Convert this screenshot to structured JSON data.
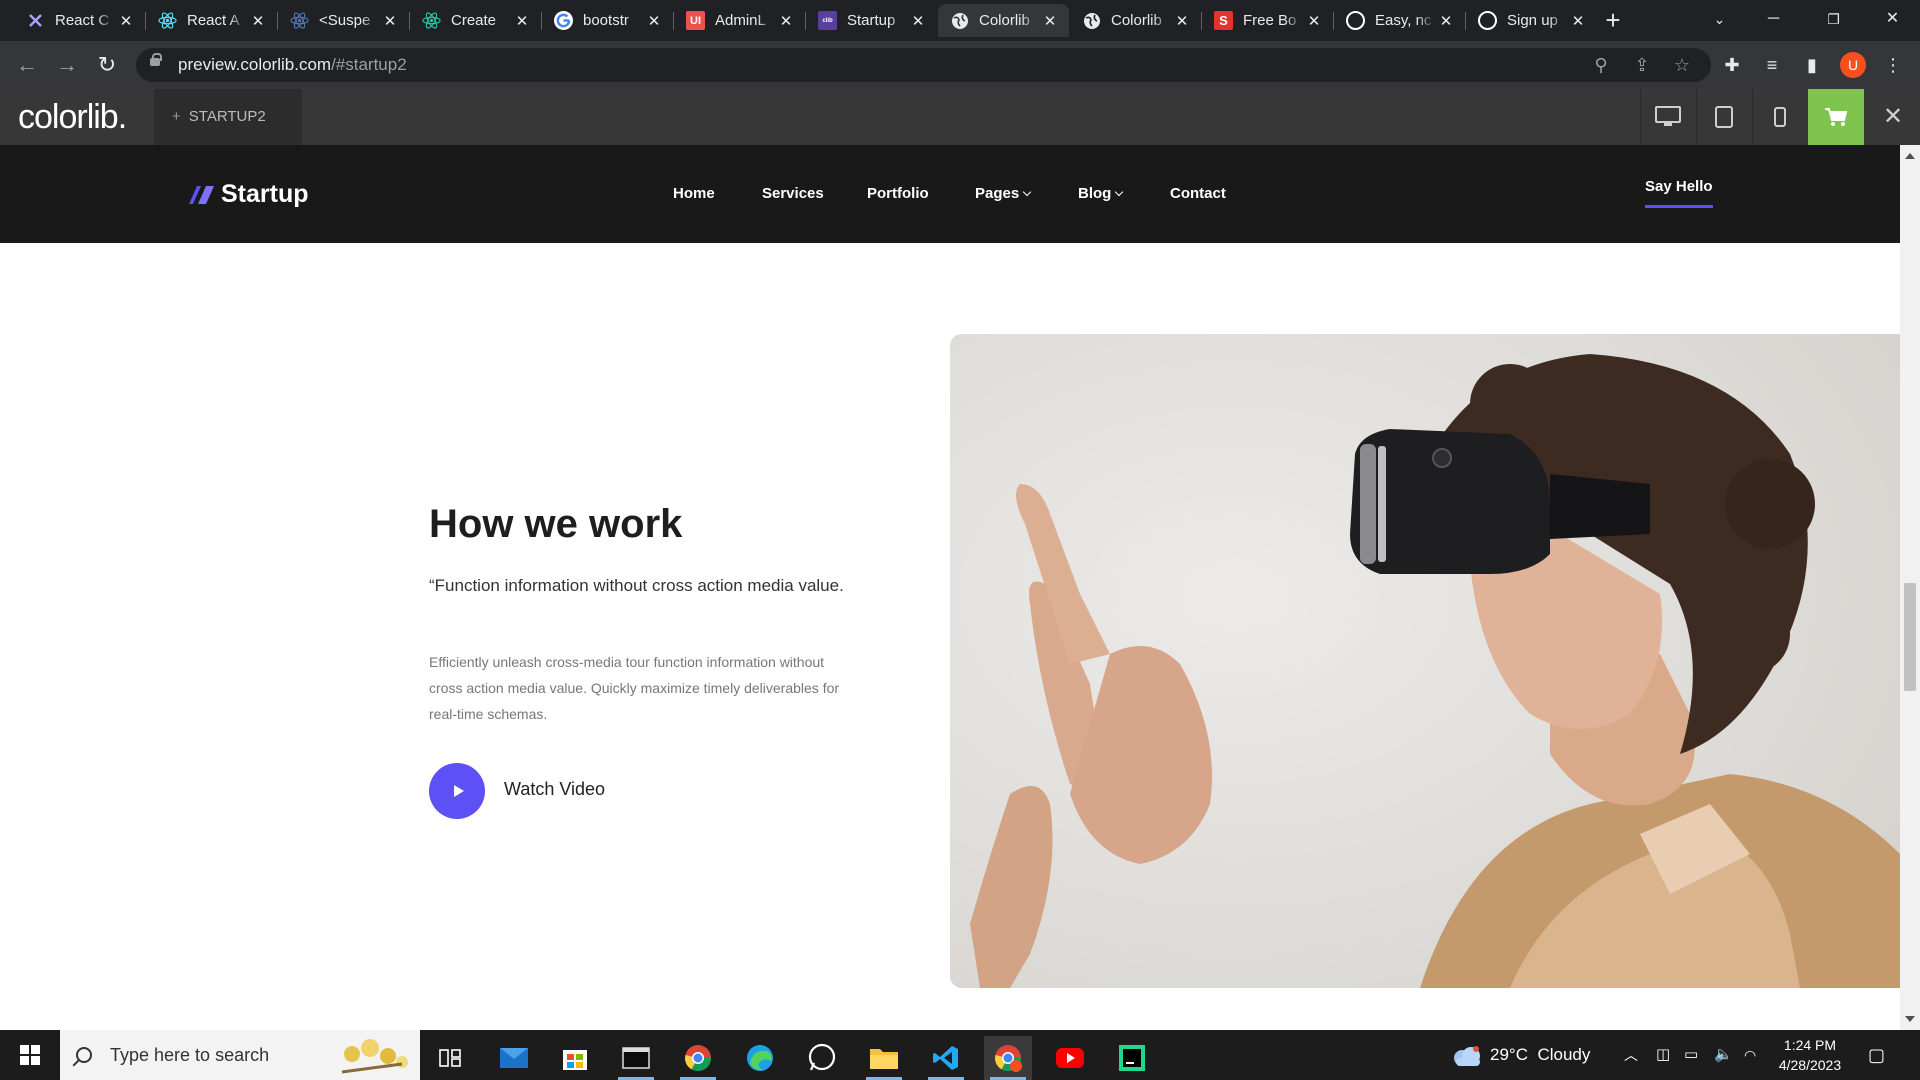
{
  "browser": {
    "tabs": [
      {
        "label": "React C",
        "favicon": "redux-icon",
        "color": "#764abc"
      },
      {
        "label": "React A",
        "favicon": "react-icon",
        "color": "#61dafb"
      },
      {
        "label": "<Suspe",
        "favicon": "react-icon",
        "color": "#61dafb"
      },
      {
        "label": "Create",
        "favicon": "react-icon",
        "color": "#61dafb"
      },
      {
        "label": "bootstr",
        "favicon": "google-icon",
        "color": "#ffffff"
      },
      {
        "label": "AdminL",
        "favicon": "ui-icon",
        "color": "#e8534b"
      },
      {
        "label": "Startup",
        "favicon": "colorlib-icon",
        "color": "#5a3ea0"
      },
      {
        "label": "Colorlib",
        "favicon": "globe-icon",
        "color": "#e8eaed",
        "active": true
      },
      {
        "label": "Colorlib",
        "favicon": "globe-icon",
        "color": "#e8eaed"
      },
      {
        "label": "Free Bo",
        "favicon": "s-icon",
        "color": "#e2342b"
      },
      {
        "label": "Easy, nc",
        "favicon": "github-icon",
        "color": "#ffffff"
      },
      {
        "label": "Sign up",
        "favicon": "github-icon",
        "color": "#ffffff"
      }
    ],
    "url_host": "preview.colorlib.com",
    "url_path": "/#startup2",
    "profile_initial": "U"
  },
  "colorlib_bar": {
    "logo": "colorlib.",
    "tab_label": "STARTUP2",
    "accent": "#7ec44e"
  },
  "site": {
    "brand": "Startup",
    "nav": [
      {
        "label": "Home"
      },
      {
        "label": "Services"
      },
      {
        "label": "Portfolio"
      },
      {
        "label": "Pages",
        "dropdown": true
      },
      {
        "label": "Blog",
        "dropdown": true
      },
      {
        "label": "Contact"
      }
    ],
    "cta": "Say Hello",
    "accent": "#5d50f5",
    "section": {
      "title": "How we work",
      "lead": "“Function information without cross action media value.",
      "body": "Efficiently unleash cross-media tour function information without cross action media value. Quickly maximize timely deliverables for real-time schemas.",
      "video_label": "Watch Video"
    }
  },
  "taskbar": {
    "search_placeholder": "Type here to search",
    "weather_temp": "29°C",
    "weather_text": "Cloudy",
    "time": "1:24 PM",
    "date": "4/28/2023",
    "apps": [
      "task-view-icon",
      "mail-icon",
      "store-icon",
      "terminal-icon",
      "chrome-icon",
      "edge-icon",
      "whatsapp-icon",
      "file-explorer-icon",
      "vscode-icon",
      "chrome-profile-icon",
      "youtube-icon",
      "pycharm-icon"
    ]
  }
}
